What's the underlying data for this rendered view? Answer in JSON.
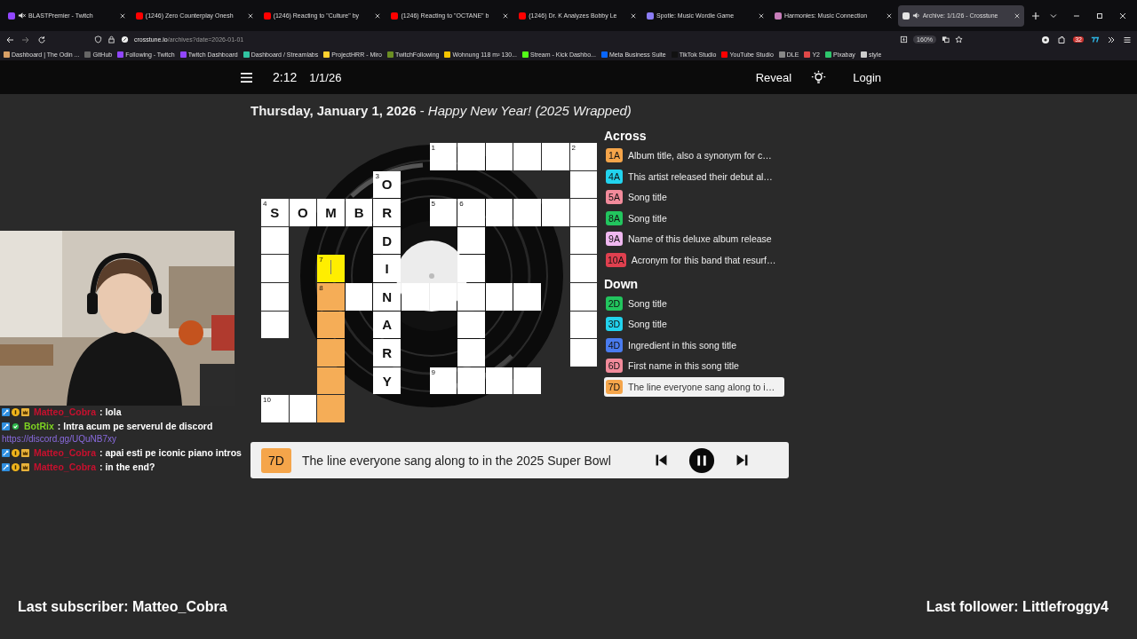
{
  "browser": {
    "tabs": [
      {
        "title": "BLASTPremier - Twitch",
        "color": "#9146ff",
        "muted": true,
        "playing": false,
        "selected": false
      },
      {
        "title": "(1246) Zero Counterplay Onesh",
        "color": "#ff0000",
        "muted": false,
        "playing": false,
        "selected": false
      },
      {
        "title": "(1246) Reacting to \"Culture\" by",
        "color": "#ff0000",
        "muted": false,
        "playing": false,
        "selected": false
      },
      {
        "title": "(1246) Reacting to \"OCTANE\" b",
        "color": "#ff0000",
        "muted": false,
        "playing": false,
        "selected": false
      },
      {
        "title": "(1246) Dr. K Analyzes Bobby Le",
        "color": "#ff0000",
        "muted": false,
        "playing": false,
        "selected": false
      },
      {
        "title": "Spotle: Music Wordle Game",
        "color": "#8b7cf6",
        "muted": false,
        "playing": false,
        "selected": false
      },
      {
        "title": "Harmonies: Music Connection",
        "color": "#c77dba",
        "muted": false,
        "playing": false,
        "selected": false
      },
      {
        "title": "Archive: 1/1/26 - Crosstune",
        "color": "#e5e5e5",
        "muted": false,
        "playing": true,
        "selected": true
      }
    ],
    "url": {
      "domain": "crosstune.io",
      "path": "/archives?date=2026-01-01"
    },
    "zoom": "160%",
    "extension_badge": "32",
    "bookmarks": [
      {
        "title": "Dashboard | The Odin ...",
        "color": "#d9a066"
      },
      {
        "title": "GitHub",
        "color": "#666666"
      },
      {
        "title": "Following - Twitch",
        "color": "#9146ff"
      },
      {
        "title": "Twitch Dashboard",
        "color": "#9146ff"
      },
      {
        "title": "Dashboard / Streamlabs",
        "color": "#31c3a2"
      },
      {
        "title": "ProjectHRR - Miro",
        "color": "#ffd02f"
      },
      {
        "title": "TwitchFollowing",
        "color": "#6b8e23"
      },
      {
        "title": "Wohnung 118 m² 130...",
        "color": "#f5c400"
      },
      {
        "title": "Stream - Kick Dashbo...",
        "color": "#53fc18"
      },
      {
        "title": "Meta Business Suite",
        "color": "#0866ff"
      },
      {
        "title": "TikTok Studio",
        "color": "#111111"
      },
      {
        "title": "YouTube Studio",
        "color": "#ff0000"
      },
      {
        "title": "DLE",
        "color": "#888888"
      },
      {
        "title": "Y2",
        "color": "#e04848"
      },
      {
        "title": "Pixabay",
        "color": "#2ec66d"
      },
      {
        "title": "style",
        "color": "#cccccc"
      }
    ]
  },
  "header": {
    "timer": "2:12",
    "date": "1/1/26",
    "reveal": "Reveal",
    "login": "Login"
  },
  "title": "**Thursday, January 1, 2026** - *Happy New Year! (2025 Wrapped)*",
  "grid": {
    "rows": [
      [
        {
          "kind": "block"
        },
        {
          "kind": "block"
        },
        {
          "kind": "block"
        },
        {
          "kind": "block"
        },
        {
          "kind": "block"
        },
        {
          "kind": "block"
        },
        {
          "kind": "white",
          "number": "1"
        },
        {
          "kind": "white"
        },
        {
          "kind": "white"
        },
        {
          "kind": "white"
        },
        {
          "kind": "white"
        },
        {
          "kind": "white",
          "number": "2"
        }
      ],
      [
        {
          "kind": "block"
        },
        {
          "kind": "block"
        },
        {
          "kind": "block"
        },
        {
          "kind": "block"
        },
        {
          "kind": "white",
          "number": "3",
          "letter": "O"
        },
        {
          "kind": "block"
        },
        {
          "kind": "block"
        },
        {
          "kind": "block"
        },
        {
          "kind": "block"
        },
        {
          "kind": "block"
        },
        {
          "kind": "block"
        },
        {
          "kind": "white"
        }
      ],
      [
        {
          "kind": "white",
          "number": "4",
          "letter": "S"
        },
        {
          "kind": "white",
          "letter": "O"
        },
        {
          "kind": "white",
          "letter": "M"
        },
        {
          "kind": "white",
          "letter": "B"
        },
        {
          "kind": "white",
          "letter": "R"
        },
        {
          "kind": "block"
        },
        {
          "kind": "white",
          "number": "5"
        },
        {
          "kind": "white",
          "number": "6"
        },
        {
          "kind": "white"
        },
        {
          "kind": "white"
        },
        {
          "kind": "white"
        },
        {
          "kind": "white"
        }
      ],
      [
        {
          "kind": "white"
        },
        {
          "kind": "block"
        },
        {
          "kind": "block"
        },
        {
          "kind": "block"
        },
        {
          "kind": "white",
          "letter": "D"
        },
        {
          "kind": "block"
        },
        {
          "kind": "block"
        },
        {
          "kind": "white"
        },
        {
          "kind": "block"
        },
        {
          "kind": "block"
        },
        {
          "kind": "block"
        },
        {
          "kind": "white"
        }
      ],
      [
        {
          "kind": "white"
        },
        {
          "kind": "block"
        },
        {
          "kind": "cursor",
          "number": "7"
        },
        {
          "kind": "block"
        },
        {
          "kind": "white",
          "letter": "I"
        },
        {
          "kind": "block"
        },
        {
          "kind": "block"
        },
        {
          "kind": "white"
        },
        {
          "kind": "block"
        },
        {
          "kind": "block"
        },
        {
          "kind": "block"
        },
        {
          "kind": "white"
        }
      ],
      [
        {
          "kind": "white"
        },
        {
          "kind": "block"
        },
        {
          "kind": "word",
          "number": "8"
        },
        {
          "kind": "white"
        },
        {
          "kind": "white",
          "letter": "N"
        },
        {
          "kind": "white"
        },
        {
          "kind": "white"
        },
        {
          "kind": "white"
        },
        {
          "kind": "white"
        },
        {
          "kind": "white"
        },
        {
          "kind": "block"
        },
        {
          "kind": "white"
        }
      ],
      [
        {
          "kind": "white"
        },
        {
          "kind": "block"
        },
        {
          "kind": "word"
        },
        {
          "kind": "block"
        },
        {
          "kind": "white",
          "letter": "A"
        },
        {
          "kind": "block"
        },
        {
          "kind": "block"
        },
        {
          "kind": "white"
        },
        {
          "kind": "block"
        },
        {
          "kind": "block"
        },
        {
          "kind": "block"
        },
        {
          "kind": "white"
        }
      ],
      [
        {
          "kind": "block"
        },
        {
          "kind": "block"
        },
        {
          "kind": "word"
        },
        {
          "kind": "block"
        },
        {
          "kind": "white",
          "letter": "R"
        },
        {
          "kind": "block"
        },
        {
          "kind": "block"
        },
        {
          "kind": "white"
        },
        {
          "kind": "block"
        },
        {
          "kind": "block"
        },
        {
          "kind": "block"
        },
        {
          "kind": "white"
        }
      ],
      [
        {
          "kind": "block"
        },
        {
          "kind": "block"
        },
        {
          "kind": "word"
        },
        {
          "kind": "block"
        },
        {
          "kind": "white",
          "letter": "Y"
        },
        {
          "kind": "block"
        },
        {
          "kind": "white",
          "number": "9"
        },
        {
          "kind": "white"
        },
        {
          "kind": "white"
        },
        {
          "kind": "white"
        },
        {
          "kind": "block"
        },
        {
          "kind": "block"
        }
      ],
      [
        {
          "kind": "white",
          "number": "10"
        },
        {
          "kind": "white"
        },
        {
          "kind": "word"
        },
        {
          "kind": "block"
        },
        {
          "kind": "block"
        },
        {
          "kind": "block"
        },
        {
          "kind": "block"
        },
        {
          "kind": "block"
        },
        {
          "kind": "block"
        },
        {
          "kind": "block"
        },
        {
          "kind": "block"
        },
        {
          "kind": "block"
        }
      ]
    ]
  },
  "clues": [
    {
      "heading": "Across",
      "items": [
        {
          "label": "1A",
          "text": "Album title, also a synonym for c…",
          "color": "#f5a54a",
          "selected": false
        },
        {
          "label": "4A",
          "text": "This artist released their debut al…",
          "color": "#22d3ee",
          "selected": false
        },
        {
          "label": "5A",
          "text": "Song title",
          "color": "#f28b9b",
          "selected": false
        },
        {
          "label": "8A",
          "text": "Song title",
          "color": "#22c55e",
          "selected": false
        },
        {
          "label": "9A",
          "text": "Name of this deluxe album release",
          "color": "#f0b8f0",
          "selected": false
        },
        {
          "label": "10A",
          "text": "Acronym for this band that resurf…",
          "color": "#e0404f",
          "selected": false
        }
      ]
    },
    {
      "heading": "Down",
      "items": [
        {
          "label": "2D",
          "text": "Song title",
          "color": "#22c55e",
          "selected": false
        },
        {
          "label": "3D",
          "text": "Song title",
          "color": "#22d3ee",
          "selected": false
        },
        {
          "label": "4D",
          "text": "Ingredient in this song title",
          "color": "#4a7cf0",
          "selected": false
        },
        {
          "label": "6D",
          "text": "First name in this song title",
          "color": "#f28b9b",
          "selected": false
        },
        {
          "label": "7D",
          "text": "The line everyone sang along to i…",
          "color": "#f5a54a",
          "selected": true
        }
      ]
    }
  ],
  "current_clue": {
    "label": "7D",
    "text": "The line everyone sang along to in the 2025 Super Bowl",
    "color": "#f5a54a"
  },
  "chat": [
    {
      "user": "Matteo_Cobra",
      "color": "#c8102e",
      "badges": [
        {
          "kind": "mod"
        },
        {
          "kind": "sub"
        },
        {
          "kind": "crown"
        }
      ],
      "text": ": lola"
    },
    {
      "user": "BotRix",
      "color": "#7ed321",
      "badges": [
        {
          "kind": "mod"
        },
        {
          "kind": "verified"
        }
      ],
      "text": ": Intra acum pe serverul de discord",
      "link": "https://discord.gg/UQuNB7xy"
    },
    {
      "user": "Matteo_Cobra",
      "color": "#c8102e",
      "badges": [
        {
          "kind": "mod"
        },
        {
          "kind": "sub"
        },
        {
          "kind": "crown"
        }
      ],
      "text": ": apai esti pe iconic piano intros"
    },
    {
      "user": "Matteo_Cobra",
      "color": "#c8102e",
      "badges": [
        {
          "kind": "mod"
        },
        {
          "kind": "sub"
        },
        {
          "kind": "crown"
        }
      ],
      "text": ": in the end?"
    }
  ],
  "overlay": {
    "last_subscriber": "Last subscriber: Matteo_Cobra",
    "last_follower": "Last follower: Littlefroggy4"
  }
}
